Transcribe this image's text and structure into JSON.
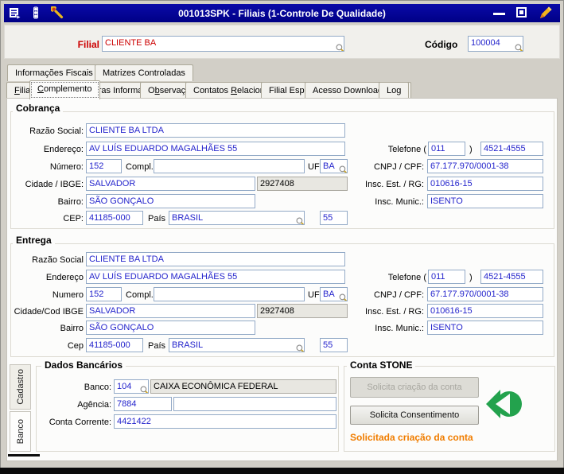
{
  "window": {
    "title": "001013SPK - Filiais (1-Controle De Qualidade)"
  },
  "header": {
    "filial_label": "Filial",
    "filial_value": "CLIENTE BA",
    "codigo_label": "Código",
    "codigo_value": "100004"
  },
  "tabs_top": [
    {
      "label": "Informações Fiscais"
    },
    {
      "label": "Matrizes Controladas"
    }
  ],
  "tabs_main": [
    {
      "pre": "",
      "key": "F",
      "post": "ilial"
    },
    {
      "pre": "",
      "key": "C",
      "post": "omplemento"
    },
    {
      "pre": "",
      "key": "O",
      "post": "utras Informações"
    },
    {
      "pre": "O",
      "key": "b",
      "post": "servações"
    },
    {
      "pre": "Contatos ",
      "key": "R",
      "post": "elacionados"
    },
    {
      "pre": "Filial Espelho",
      "key": "",
      "post": ""
    },
    {
      "pre": "Acesso Download XML",
      "key": "",
      "post": ""
    },
    {
      "pre": "Log",
      "key": "",
      "post": ""
    }
  ],
  "cobranca": {
    "title": "Cobrança",
    "razao_social_label": "Razão Social:",
    "razao_social": "CLIENTE BA LTDA",
    "endereco_label": "Endereço:",
    "endereco": "AV LUÍS EDUARDO MAGALHÃES 55",
    "numero_label": "Número:",
    "numero": "152",
    "compl_label": "Compl.",
    "compl": "",
    "uf_label": "UF",
    "uf": "BA",
    "cidade_label": "Cidade / IBGE:",
    "cidade": "SALVADOR",
    "ibge": "2927408",
    "bairro_label": "Bairro:",
    "bairro": "SÃO GONÇALO",
    "cep_label": "CEP:",
    "cep": "41185-000",
    "pais_label": "País",
    "pais": "BRASIL",
    "pais_cod": "55",
    "telefone_label": "Telefone (",
    "telefone_close": ")",
    "telefone_ddd": "011",
    "telefone_num": "4521-4555",
    "cnpj_label": "CNPJ / CPF:",
    "cnpj": "67.177.970/0001-38",
    "insc_est_label": "Insc. Est. / RG:",
    "insc_est": "010616-15",
    "insc_mun_label": "Insc. Munic.:",
    "insc_mun": "ISENTO"
  },
  "entrega": {
    "title": "Entrega",
    "razao_social_label": "Razão Social",
    "razao_social": "CLIENTE BA LTDA",
    "endereco_label": "Endereço",
    "endereco": "AV LUÍS EDUARDO MAGALHÃES 55",
    "numero_label": "Numero",
    "numero": "152",
    "compl_label": "Compl.",
    "compl": "",
    "uf_label": "UF",
    "uf": "BA",
    "cidade_label": "Cidade/Cod IBGE",
    "cidade": "SALVADOR",
    "ibge": "2927408",
    "bairro_label": "Bairro",
    "bairro": "SÃO GONÇALO",
    "cep_label": "Cep",
    "cep": "41185-000",
    "pais_label": "País",
    "pais": "BRASIL",
    "pais_cod": "55",
    "telefone_label": "Telefone (",
    "telefone_close": ")",
    "telefone_ddd": "011",
    "telefone_num": "4521-4555",
    "cnpj_label": "CNPJ / CPF:",
    "cnpj": "67.177.970/0001-38",
    "insc_est_label": "Insc. Est. / RG:",
    "insc_est": "010616-15",
    "insc_mun_label": "Insc. Munic.:",
    "insc_mun": "ISENTO"
  },
  "side_tabs": {
    "cadastro": "Cadastro",
    "banco": "Banco"
  },
  "dados_bancarios": {
    "title": "Dados Bancários",
    "banco_label": "Banco:",
    "banco_cod": "104",
    "banco_nome": "CAIXA ECONÔMICA FEDERAL",
    "agencia_label": "Agência:",
    "agencia": "7884",
    "agencia_digito": "",
    "conta_label": "Conta Corrente:",
    "conta": "4421422"
  },
  "conta_stone": {
    "title": "Conta STONE",
    "btn_criacao": "Solicita criação da conta",
    "btn_consentimento": "Solicita Consentimento",
    "status": "Solicitada criação da conta"
  },
  "colors": {
    "titlebar_blue": "#0000A0",
    "value_blue": "#2424CC",
    "alert_red": "#CC0000",
    "status_orange": "#F07D00",
    "stone_green": "#23A24D"
  }
}
